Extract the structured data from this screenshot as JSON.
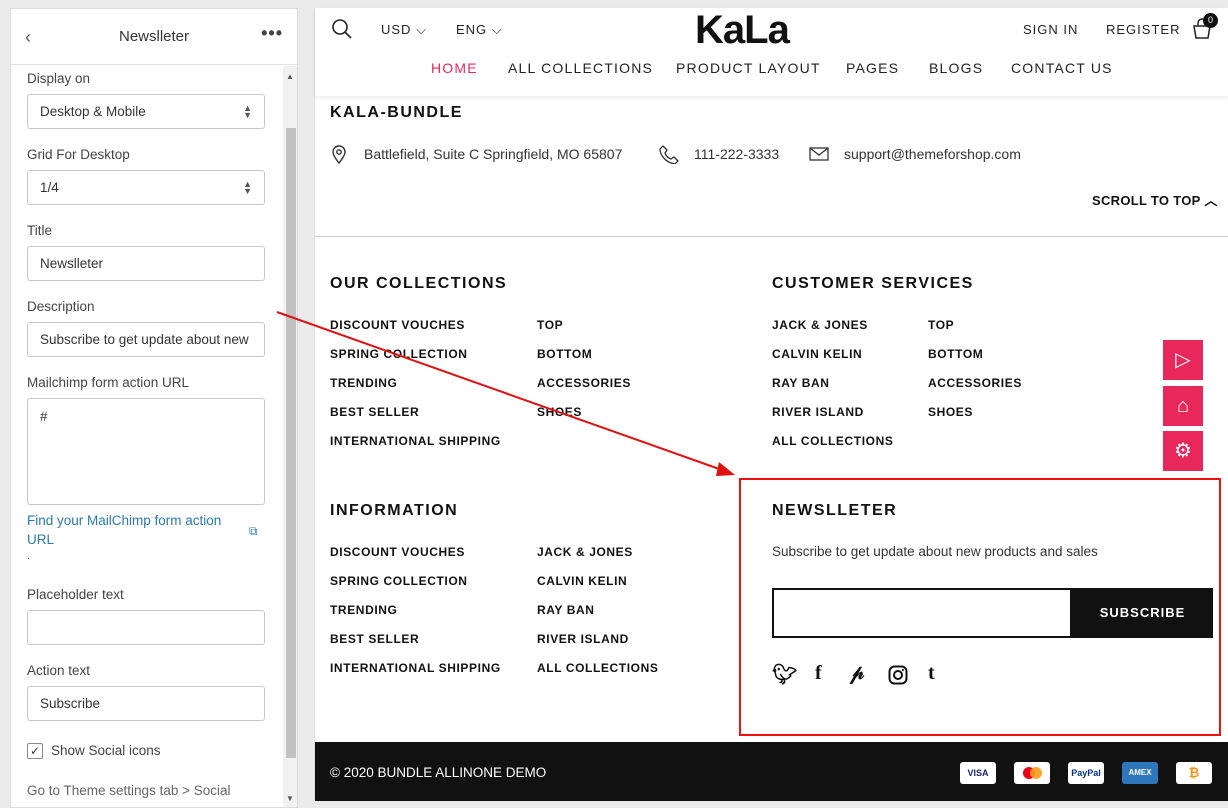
{
  "panel": {
    "title": "Newslleter",
    "back": "‹",
    "more": "•••",
    "display_label": "Display on",
    "display_value": "Desktop & Mobile",
    "grid_label": "Grid For Desktop",
    "grid_value": "1/4",
    "title_label": "Title",
    "title_value": "Newslleter",
    "desc_label": "Description",
    "desc_value": "Subscribe to get update about new",
    "mc_label": "Mailchimp form action URL",
    "mc_value": "#",
    "mc_link": "Find your MailChimp form action URL",
    "dot": ".",
    "ph_label": "Placeholder text",
    "ph_value": "",
    "action_label": "Action text",
    "action_value": "Subscribe",
    "social_label": "Show Social icons",
    "social_checked": true,
    "tail": "Go to Theme settings tab > Social"
  },
  "header": {
    "currency": "USD",
    "lang": "ENG",
    "logo": "KaLa",
    "sign_in": "SIGN IN",
    "register": "REGISTER",
    "cart_count": "0",
    "nav": [
      "HOME",
      "ALL COLLECTIONS",
      "PRODUCT LAYOUT",
      "PAGES",
      "BLOGS",
      "CONTACT US"
    ],
    "nav_active_color": "#e8285a"
  },
  "store": {
    "name": "KALA-BUNDLE",
    "address": "Battlefield, Suite C Springfield, MO 65807",
    "phone": "111-222-3333",
    "email": "support@themeforshop.com",
    "scroll_top": "SCROLL TO TOP"
  },
  "collections": {
    "title": "OUR COLLECTIONS",
    "col1": [
      "DISCOUNT VOUCHES",
      "SPRING COLLECTION",
      "TRENDING",
      "BEST SELLER",
      "INTERNATIONAL SHIPPING"
    ],
    "col2": [
      "TOP",
      "BOTTOM",
      "ACCESSORIES",
      "SHOES"
    ]
  },
  "services": {
    "title": "CUSTOMER SERVICES",
    "col1": [
      "JACK & JONES",
      "CALVIN KELIN",
      "RAY BAN",
      "RIVER ISLAND",
      "ALL COLLECTIONS"
    ],
    "col2": [
      "TOP",
      "BOTTOM",
      "ACCESSORIES",
      "SHOES"
    ]
  },
  "information": {
    "title": "INFORMATION",
    "col1": [
      "DISCOUNT VOUCHES",
      "SPRING COLLECTION",
      "TRENDING",
      "BEST SELLER",
      "INTERNATIONAL SHIPPING"
    ],
    "col2": [
      "JACK & JONES",
      "CALVIN KELIN",
      "RAY BAN",
      "RIVER ISLAND",
      "ALL COLLECTIONS"
    ]
  },
  "newsletter": {
    "title": "NEWSLLETER",
    "desc": "Subscribe to get update about new products and sales",
    "button": "SUBSCRIBE",
    "social": [
      "twitter-icon",
      "facebook-icon",
      "pinterest-icon",
      "instagram-icon",
      "tumblr-icon"
    ]
  },
  "footer": {
    "copyright": "© 2020 BUNDLE ALLINONE DEMO",
    "payments": [
      "VISA",
      "MC",
      "PayPal",
      "AMEX",
      "₿"
    ]
  },
  "annotation_color": "#e11111"
}
